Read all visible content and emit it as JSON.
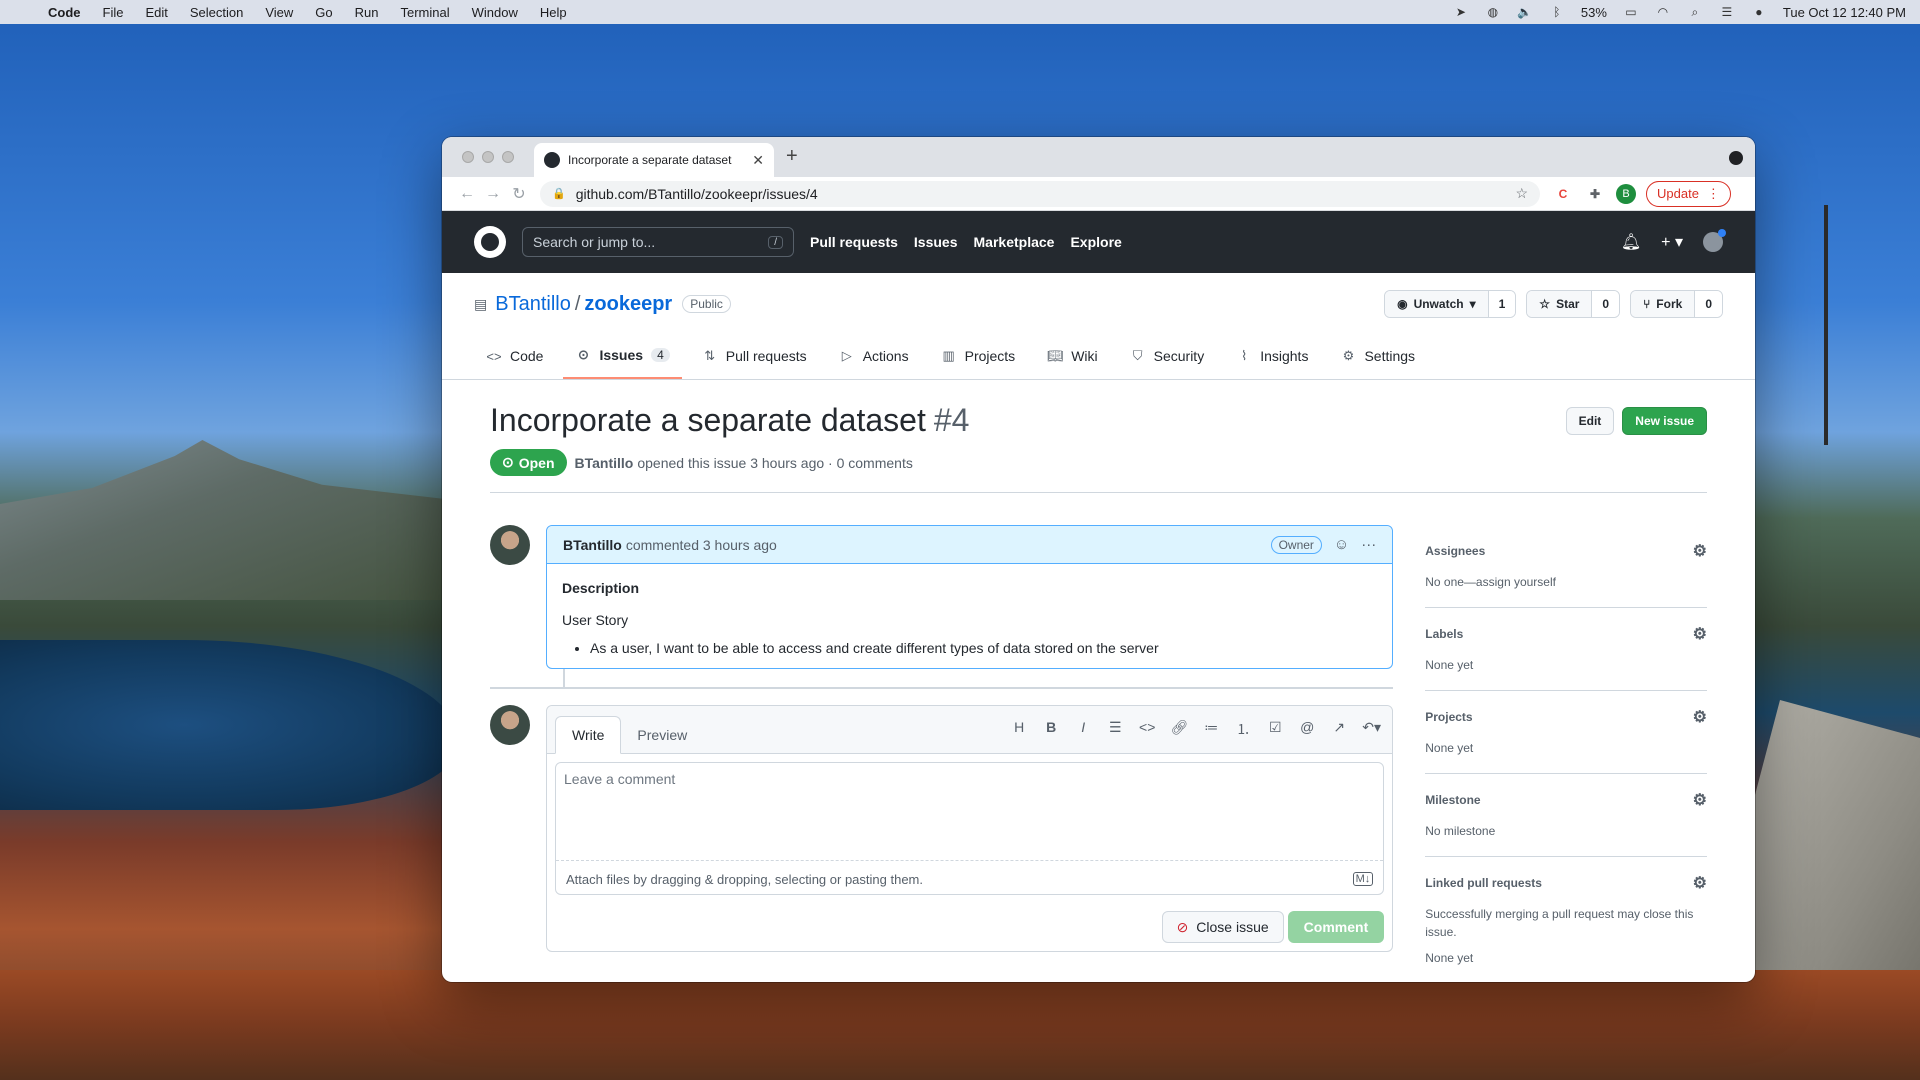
{
  "menubar": {
    "app": "Code",
    "items": [
      "File",
      "Edit",
      "Selection",
      "View",
      "Go",
      "Run",
      "Terminal",
      "Window",
      "Help"
    ],
    "battery": "53%",
    "clock": "Tue Oct 12  12:40 PM"
  },
  "browser": {
    "tab_title": "Incorporate a separate dataset",
    "url": "github.com/BTantillo/zookeepr/issues/4",
    "profile_initial": "B",
    "update_label": "Update"
  },
  "gh_header": {
    "search_placeholder": "Search or jump to...",
    "search_shortcut": "/",
    "nav": [
      "Pull requests",
      "Issues",
      "Marketplace",
      "Explore"
    ]
  },
  "repo": {
    "owner": "BTantillo",
    "separator": "/",
    "name": "zookeepr",
    "visibility": "Public",
    "unwatch_label": "Unwatch",
    "watch_count": "1",
    "star_label": "Star",
    "star_count": "0",
    "fork_label": "Fork",
    "fork_count": "0",
    "tabs": [
      {
        "label": "Code",
        "icon": "code-icon"
      },
      {
        "label": "Issues",
        "icon": "issue-icon",
        "counter": "4",
        "active": true
      },
      {
        "label": "Pull requests",
        "icon": "pull-request-icon"
      },
      {
        "label": "Actions",
        "icon": "play-icon"
      },
      {
        "label": "Projects",
        "icon": "project-icon"
      },
      {
        "label": "Wiki",
        "icon": "book-icon"
      },
      {
        "label": "Security",
        "icon": "shield-icon"
      },
      {
        "label": "Insights",
        "icon": "graph-icon"
      },
      {
        "label": "Settings",
        "icon": "gear-icon"
      }
    ]
  },
  "issue": {
    "title": "Incorporate a separate dataset",
    "number": "#4",
    "edit_label": "Edit",
    "new_issue_label": "New issue",
    "state": "Open",
    "author": "BTantillo",
    "meta_text": "opened this issue 3 hours ago · 0 comments"
  },
  "comment": {
    "author": "BTantillo",
    "meta": "commented 3 hours ago",
    "role_badge": "Owner",
    "heading": "Description",
    "paragraph": "User Story",
    "bullet": "As a user, I want to be able to access and create different types of data stored on the server"
  },
  "compose": {
    "write_tab": "Write",
    "preview_tab": "Preview",
    "placeholder": "Leave a comment",
    "attach_hint": "Attach files by dragging & dropping, selecting or pasting them.",
    "close_issue_label": "Close issue",
    "comment_label": "Comment"
  },
  "sidebar": {
    "assignees_title": "Assignees",
    "assignees_value": "No one—assign yourself",
    "labels_title": "Labels",
    "labels_value": "None yet",
    "projects_title": "Projects",
    "projects_value": "None yet",
    "milestone_title": "Milestone",
    "milestone_value": "No milestone",
    "linked_title": "Linked pull requests",
    "linked_desc": "Successfully merging a pull request may close this issue.",
    "linked_value": "None yet"
  },
  "colors": {
    "open_green": "#2da44e",
    "link_blue": "#0969da",
    "header_dark": "#24292f",
    "active_tab_underline": "#fd8c73"
  }
}
